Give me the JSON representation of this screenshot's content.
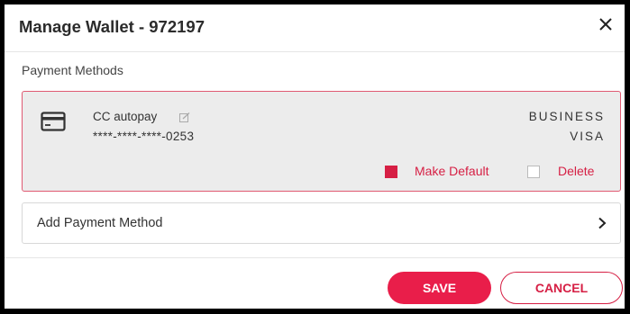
{
  "dialog": {
    "title": "Manage Wallet - 972197",
    "close_icon": "close-icon"
  },
  "payment_methods": {
    "section_label": "Payment Methods",
    "cards": [
      {
        "icon": "credit-card-icon",
        "name": "CC autopay",
        "edit_icon": "edit-icon",
        "number": "****-****-****-0253",
        "brand_line1": "BUSINESS",
        "brand_line2": "VISA",
        "make_default": {
          "label": "Make Default",
          "checked": true
        },
        "delete": {
          "label": "Delete",
          "checked": false
        }
      }
    ],
    "add_label": "Add Payment Method",
    "add_icon": "chevron-right-icon"
  },
  "actions": {
    "save_label": "SAVE",
    "cancel_label": "CANCEL"
  },
  "colors": {
    "accent": "#e91e4a",
    "card_border": "#e05a72",
    "card_background": "#ececec"
  }
}
